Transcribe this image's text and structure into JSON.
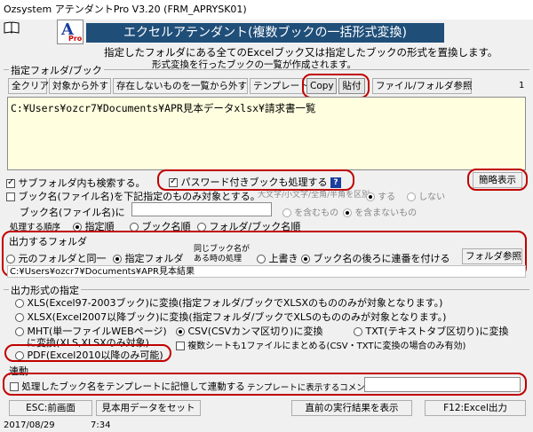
{
  "window": {
    "title": "Ozsystem アテンダントPro V3.20 (FRM_APRYSK01)"
  },
  "logo": {
    "letter": "A",
    "sub": "Pro"
  },
  "header": {
    "banner": "エクセルアテンダント(複数ブックの一括形式変換)",
    "desc1": "指定したフォルダにある全てのExcelブック又は指定したブックの形式を置換します。",
    "desc2": "形式変換を行ったブックの一覧が作成されます。"
  },
  "folderSection": {
    "title": "指定フォルダ/ブック",
    "buttons": {
      "clearAll": "全クリア",
      "removeTarget": "対象から外す",
      "removeNonexist": "存在しないものを一覧から外す",
      "template": "テンプレート",
      "copy": "Copy",
      "paste": "貼付",
      "browse": "ファイル/フォルダ参照"
    },
    "count": "1",
    "path": "C:¥Users¥ozcr7¥Documents¥APR見本データxlsx¥請求書一覧"
  },
  "options": {
    "subfolder": "サブフォルダ内も検索する。",
    "passwordBooks": "パスワード付きブックも処理する",
    "helpMark": "?",
    "simpleView": "簡略表示",
    "nameFilter": "ブック名(ファイル名)を下記指定のものみ対象とする。",
    "caseLabel": "大文字/小文字/全角/半角を区別",
    "caseYes": "する",
    "caseNo": "しない",
    "bookNameLabel": "ブック名(ファイル名)に",
    "containYes": "を含むもの",
    "containNo": "を含まないもの",
    "orderLabel": "処理する順序",
    "order": [
      "指定順",
      "ブック名順",
      "フォルダ/ブック名順"
    ]
  },
  "outputFolder": {
    "title": "出力するフォルダ",
    "same": "元のフォルダと同一",
    "specified": "指定フォルダ",
    "dupLabel1": "同じブック名が",
    "dupLabel2": "ある時の処理",
    "overwrite": "上書き",
    "serial": "ブック名の後ろに連番を付ける",
    "browse": "フォルダ参照",
    "path": "C:¥Users¥ozcr7¥Documents¥APR見本結果"
  },
  "format": {
    "title": "出力形式の指定",
    "xls": "XLS(Excel97-2003ブック)に変換(指定フォルダ/ブックでXLSXのもののみが対象となります。)",
    "xlsx": "XLSX(Excel2007以降ブック)に変換(指定フォルダ/ブックでXLSのもののみが対象となります。)",
    "mht1": "MHT(単一ファイルWEBページ)",
    "mht2": "に変換(XLS,XLSXのみ対象)",
    "csv": "CSV(CSVカンマ区切り)に変換",
    "txt": "TXT(テキストタブ区切り)に変換",
    "multiSheet": "複数シートも1ファイルにまとめる(CSV・TXTに変換の場合のみ有効)",
    "pdf": "PDF(Excel2010以降のみ可能)"
  },
  "link": {
    "title": "連動",
    "remember": "処理したブック名をテンプレートに記憶して連動する",
    "commentLabel": "テンプレートに表示するコメント",
    "comment": ""
  },
  "footer": {
    "esc": "ESC:前画面",
    "sample": "見本用データをセット",
    "lastResult": "直前の実行結果を表示",
    "f12": "F12:Excel出力"
  },
  "status": {
    "date": "2017/08/29",
    "time": "7:34"
  },
  "colors": {
    "banner": "#1f4e79",
    "highlight": "#c00000",
    "pathBg": "#ffffe0"
  }
}
